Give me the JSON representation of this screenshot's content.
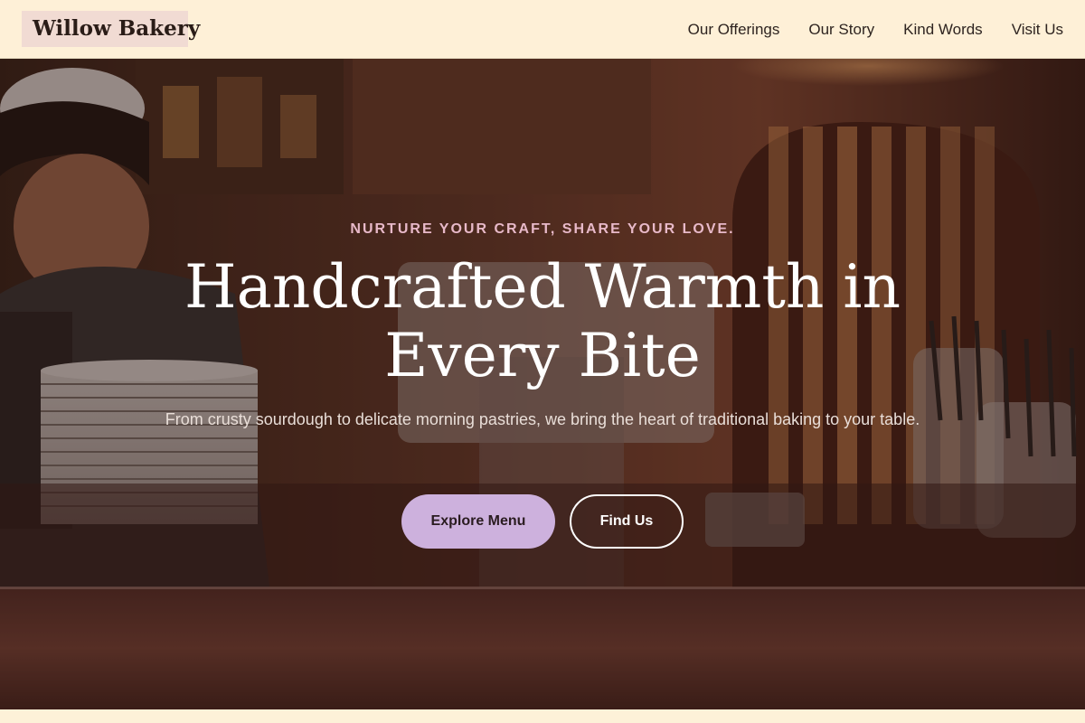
{
  "brand": {
    "name": "Willow Bakery"
  },
  "nav": {
    "links": [
      {
        "label": "Our Offerings"
      },
      {
        "label": "Our Story"
      },
      {
        "label": "Kind Words"
      },
      {
        "label": "Visit Us"
      }
    ]
  },
  "hero": {
    "tagline": "NURTURE YOUR CRAFT, SHARE YOUR LOVE.",
    "headline_line1": "Handcrafted Warmth in",
    "headline_line2": "Every Bite",
    "subtext": "From crusty sourdough to delicate morning pastries, we bring the heart of traditional baking to your table.",
    "primary_button": "Explore Menu",
    "secondary_button": "Find Us"
  },
  "colors": {
    "header_bg": "#fef0d7",
    "logo_bg": "#f1dbd3",
    "tagline": "#e8b9c9",
    "primary_button": "#cdb1dd",
    "hero_tint": "#23120e"
  }
}
